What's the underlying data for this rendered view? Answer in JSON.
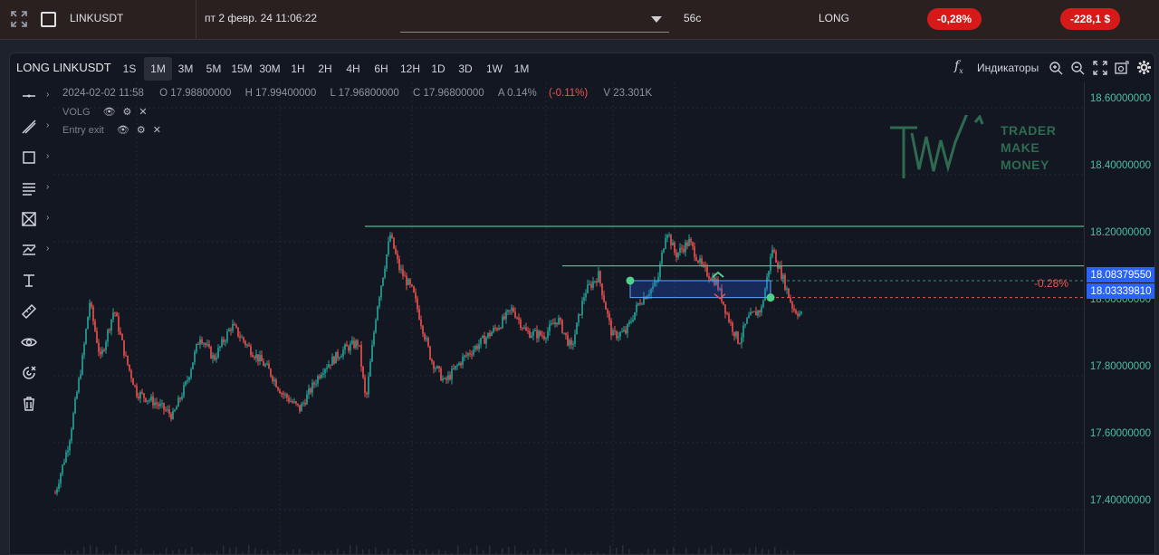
{
  "topbar": {
    "symbol": "LINKUSDT",
    "datetime": "пт 2 февр. 24 11:06:22",
    "duration": "56с",
    "direction": "LONG",
    "pnl_percent": "-0,28%",
    "pnl_amount": "-228,1 $"
  },
  "chart": {
    "title": "LONG LINKUSDT",
    "timeframes": [
      "1S",
      "1M",
      "3M",
      "5M",
      "15M",
      "30M",
      "1H",
      "2H",
      "4H",
      "6H",
      "12H",
      "1D",
      "3D",
      "1W",
      "1M"
    ],
    "active_timeframe_index": 1,
    "indicators_label": "Индикаторы",
    "ohlc": {
      "date": "2024-02-02 11:58",
      "open": "O 17.98800000",
      "high": "H 17.99400000",
      "low": "L 17.96800000",
      "close": "C 17.96800000",
      "change": "A 0.14%",
      "change_pct": "(-0.11%)",
      "volume": "V 23.301K"
    },
    "indicators": [
      "VOLG",
      "Entry exit"
    ],
    "price_labels": [
      "18.60000000",
      "18.40000000",
      "18.20000000",
      "18.00000000",
      "17.80000000",
      "17.60000000",
      "17.40000000"
    ],
    "entry_price": "18.08379550",
    "exit_price": "18.03339810",
    "trade_pct": "-0.28%",
    "logo": [
      "TRADER",
      "MAKE",
      "MONEY"
    ],
    "colors": {
      "up": "#26a69a",
      "down": "#ef5350",
      "level": "#3fbf8f",
      "accent": "#2962ff"
    }
  }
}
